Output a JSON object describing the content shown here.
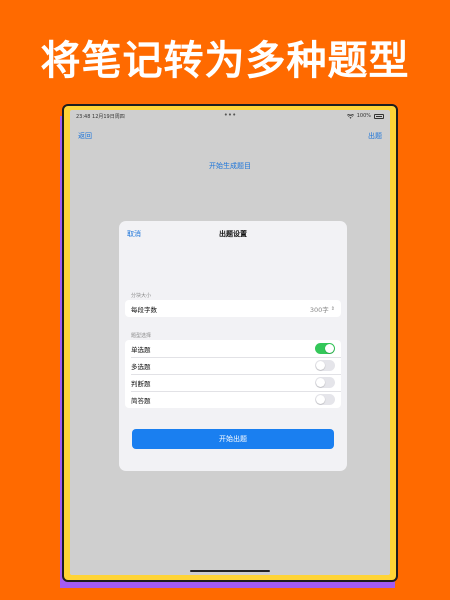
{
  "headline": "将笔记转为多种题型",
  "status_bar": {
    "time": "23:48",
    "date": "12月19日周四",
    "dots": "•••",
    "battery_text": "100%"
  },
  "nav": {
    "back_label": "返回",
    "action_label": "出题"
  },
  "main": {
    "generate_link": "开始生成题目"
  },
  "modal": {
    "cancel_label": "取消",
    "title": "出题设置",
    "chunk_section": {
      "label": "分块大小",
      "row_label": "每段字数",
      "value": "300字"
    },
    "type_section": {
      "label": "题型选择",
      "items": [
        {
          "label": "单选题",
          "enabled": true
        },
        {
          "label": "多选题",
          "enabled": false
        },
        {
          "label": "判断题",
          "enabled": false
        },
        {
          "label": "简答题",
          "enabled": false
        }
      ]
    },
    "start_label": "开始出题"
  },
  "colors": {
    "background": "#FF6A00",
    "accent": "#1a7ff0",
    "toggle_on": "#34C759",
    "frame": "#FFD436",
    "shadow_panel": "#A35BF2"
  },
  "icons": {
    "wifi": "wifi-icon",
    "battery": "battery-icon",
    "stepper": "chevron-up-down-icon"
  }
}
